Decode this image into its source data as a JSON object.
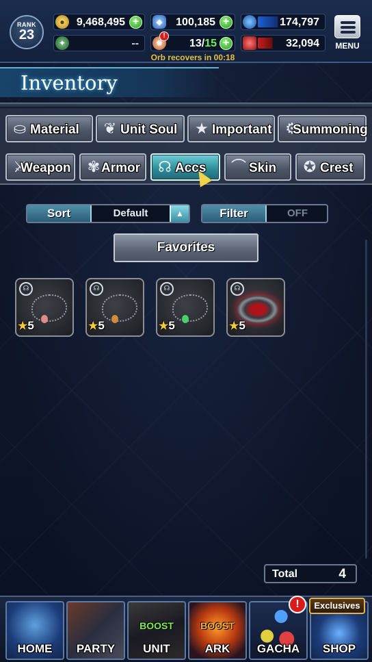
{
  "header": {
    "rank_label": "RANK",
    "rank_value": "23",
    "gil": "9,468,495",
    "lapis": "100,185",
    "exp": "174,797",
    "arena": "--",
    "orbs_current": "13",
    "orbs_max": "15",
    "hp": "32,094",
    "orb_recover": "Orb recovers in 00:18",
    "menu_label": "MENU",
    "orb_alert": "!"
  },
  "title": "Inventory",
  "categories_row1": [
    {
      "label": "Material"
    },
    {
      "label": "Unit Soul"
    },
    {
      "label": "Important"
    },
    {
      "label": "Summoning"
    }
  ],
  "categories_row2": [
    {
      "label": "Weapon"
    },
    {
      "label": "Armor"
    },
    {
      "label": "Accs"
    },
    {
      "label": "Skin"
    },
    {
      "label": "Crest"
    }
  ],
  "active_tab": "Accs",
  "sort": {
    "label": "Sort",
    "value": "Default"
  },
  "filter": {
    "label": "Filter",
    "value": "OFF"
  },
  "favorites_label": "Favorites",
  "items": [
    {
      "rarity": "5"
    },
    {
      "rarity": "5"
    },
    {
      "rarity": "5"
    },
    {
      "rarity": "5"
    }
  ],
  "total": {
    "label": "Total",
    "value": "4"
  },
  "nav": {
    "home": "HOME",
    "party": "PARTY",
    "unit": "UNIT",
    "unit_boost": "BOOST",
    "ark": "ARK",
    "ark_boost": "BOOST",
    "gacha": "GACHA",
    "gacha_alert": "!",
    "shop": "SHOP",
    "shop_exclusives": "Exclusives"
  },
  "colors": {
    "accent_active_tab": "#2f8f9c",
    "plus_button": "#2c9a26",
    "orb_max": "#6af05a",
    "orb_recover_text": "#e6c23a",
    "star": "#f4c93a"
  }
}
